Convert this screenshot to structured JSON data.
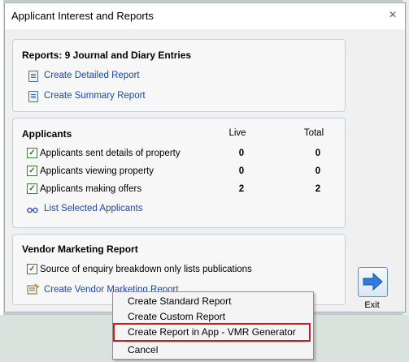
{
  "dialog": {
    "title": "Applicant Interest and Reports"
  },
  "reports": {
    "title": "Reports: 9 Journal and Diary Entries",
    "links": [
      {
        "label": "Create Detailed Report"
      },
      {
        "label": "Create Summary Report"
      }
    ]
  },
  "applicants": {
    "title": "Applicants",
    "columns": [
      "Live",
      "Total"
    ],
    "rows": [
      {
        "label": "Applicants sent details of property",
        "checked": true,
        "live": "0",
        "total": "0"
      },
      {
        "label": "Applicants viewing property",
        "checked": true,
        "live": "0",
        "total": "0"
      },
      {
        "label": "Applicants making offers",
        "checked": true,
        "live": "2",
        "total": "2"
      }
    ],
    "list_link": "List Selected Applicants"
  },
  "vendor": {
    "title": "Vendor Marketing Report",
    "option": {
      "label": "Source of enquiry breakdown only lists publications",
      "checked": true
    },
    "link": "Create Vendor Marketing Report"
  },
  "exit": {
    "label": "Exit",
    "icon": "arrow-right-icon"
  },
  "context_menu": {
    "items": [
      {
        "label": "Create Standard Report"
      },
      {
        "label": "Create Custom Report"
      },
      {
        "label": "Create Report in App - VMR Generator",
        "highlighted": true
      },
      {
        "label": "Cancel"
      }
    ]
  },
  "colors": {
    "link": "#1f47a8",
    "highlight_border": "#d11a1a",
    "checkbox": "#2a7a2a"
  }
}
